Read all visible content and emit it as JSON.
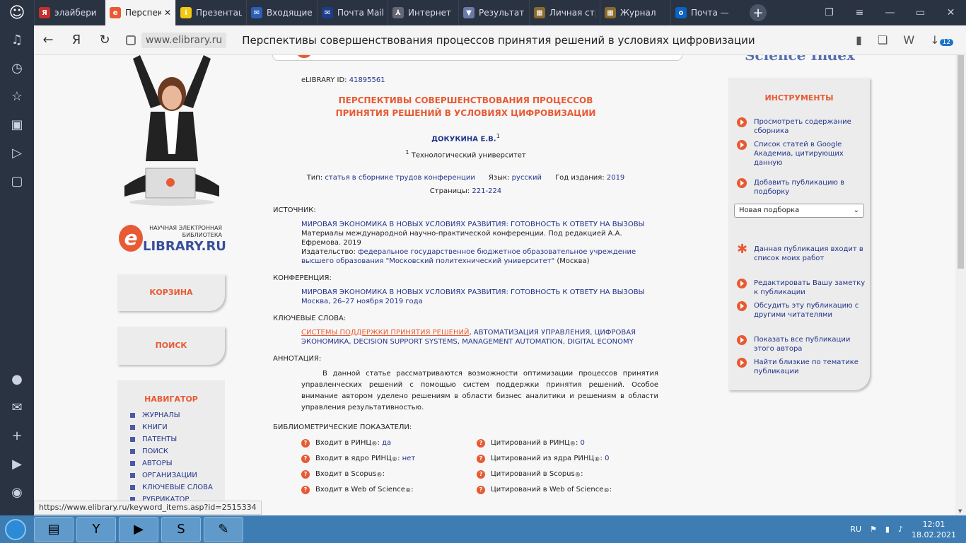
{
  "tabs": [
    {
      "label": "элайбери",
      "color": "#c4302b",
      "glyph": "Я"
    },
    {
      "label": "Перспективы",
      "color": "#e85a33",
      "glyph": "e",
      "active": true
    },
    {
      "label": "Презентация",
      "color": "#f2c811",
      "glyph": "i"
    },
    {
      "label": "Входящие",
      "color": "#2b5eb5",
      "glyph": "✉"
    },
    {
      "label": "Почта Mail",
      "color": "#1e3c8c",
      "glyph": "✉"
    },
    {
      "label": "Интернет",
      "color": "#667",
      "glyph": "⅄"
    },
    {
      "label": "Результаты",
      "color": "#6a7aa8",
      "glyph": "▼"
    },
    {
      "label": "Личная страница",
      "color": "#8a6a2a",
      "glyph": "▦"
    },
    {
      "label": "Журнал",
      "color": "#8a6a2a",
      "glyph": "▦"
    },
    {
      "label": "Почта —",
      "color": "#0a64c4",
      "glyph": "o"
    }
  ],
  "address": {
    "domain": "www.elibrary.ru",
    "title": "Перспективы совершенствования процессов принятия решений в условиях цифровизации",
    "downloads": "12"
  },
  "sidebar_logo": {
    "small": "НАУЧНАЯ ЭЛЕКТРОННАЯ БИБЛИОТЕКА",
    "big": "LIBRARY.RU",
    "e": "e"
  },
  "left": {
    "cart": "КОРЗИНА",
    "search": "ПОИСК",
    "nav_title": "НАВИГАТОР",
    "nav_items": [
      "ЖУРНАЛЫ",
      "КНИГИ",
      "ПАТЕНТЫ",
      "ПОИСК",
      "АВТОРЫ",
      "ОРГАНИЗАЦИИ",
      "КЛЮЧЕВЫЕ СЛОВА",
      "РУБРИКАТОР"
    ]
  },
  "science_index": "Science Index",
  "article": {
    "id_label": "eLIBRARY ID:",
    "id": "41895561",
    "title": "ПЕРСПЕКТИВЫ СОВЕРШЕНСТВОВАНИЯ ПРОЦЕССОВ ПРИНЯТИЯ РЕШЕНИЙ В УСЛОВИЯХ ЦИФРОВИЗАЦИИ",
    "author": "ДОКУКИНА Е.В.",
    "author_sup": "1",
    "aff_sup": "1",
    "affiliation": "Технологический университет",
    "type_label": "Тип:",
    "type": "статья в сборнике трудов конференции",
    "lang_label": "Язык:",
    "lang": "русский",
    "year_label": "Год издания:",
    "year": "2019",
    "pages_label": "Страницы:",
    "pages": "221-224",
    "source_h": "ИСТОЧНИК:",
    "source_title": "МИРОВАЯ ЭКОНОМИКА В НОВЫХ УСЛОВИЯХ РАЗВИТИЯ: ГОТОВНОСТЬ К ОТВЕТУ НА ВЫЗОВЫ",
    "source_l2": "Материалы международной научно-практической конференции. Под редакцией А.А. Ефремова. 2019",
    "source_l3a": "Издательство:",
    "source_l3b": "федеральное государственное бюджетное образовательное учреждение высшего образования \"Московский политехнический университет\"",
    "source_l3c": "(Москва)",
    "conf_h": "КОНФЕРЕНЦИЯ:",
    "conf_title": "МИРОВАЯ ЭКОНОМИКА В НОВЫХ УСЛОВИЯХ РАЗВИТИЯ: ГОТОВНОСТЬ К ОТВЕТУ НА ВЫЗОВЫ",
    "conf_place": "Москва, 26–27 ноября 2019 года",
    "kw_h": "КЛЮЧЕВЫЕ СЛОВА:",
    "kw_first": "СИСТЕМЫ ПОДДЕРЖКИ ПРИНЯТИЯ РЕШЕНИЙ",
    "kw_rest": ", АВТОМАТИЗАЦИЯ УПРАВЛЕНИЯ, ЦИФРОВАЯ ЭКОНОМИКА, DECISION SUPPORT SYSTEMS, MANAGEMENT AUTOMATION, DIGITAL ECONOMY",
    "abs_h": "АННОТАЦИЯ:",
    "abstract": "В данной статье рассматриваются возможности оптимизации процессов принятия управленческих решений с помощью систем поддержки принятия решений. Особое внимание автором уделено решениям в области бизнес аналитики и решениям в области управления результативностью.",
    "bib_h": "БИБЛИОМЕТРИЧЕСКИЕ ПОКАЗАТЕЛИ:",
    "bib_left": [
      [
        "Входит в РИНЦ",
        "да"
      ],
      [
        "Входит в ядро РИНЦ",
        "нет"
      ],
      [
        "Входит в Scopus",
        ""
      ],
      [
        "Входит в Web of Science",
        ""
      ]
    ],
    "bib_right": [
      [
        "Цитирований в РИНЦ",
        "0"
      ],
      [
        "Цитирований из ядра РИНЦ",
        "0"
      ],
      [
        "Цитирований в Scopus",
        ""
      ],
      [
        "Цитирований в Web of Science",
        ""
      ]
    ]
  },
  "tools": {
    "title": "ИНСТРУМЕНТЫ",
    "items": [
      "Просмотреть содержание сборника",
      "Список статей в Google Академиа, цитирующих данную",
      "Добавить публикацию в подборку",
      "Данная публикация входит в список моих работ",
      "Редактировать Вашу заметку к публикации",
      "Обсудить эту публикацию с другими читателями",
      "Показать все публикации этого автора",
      "Найти близкие по тематике публикации"
    ],
    "select": "Новая подборка"
  },
  "status_url": "https://www.elibrary.ru/keyword_items.asp?id=2515334",
  "taskbar": {
    "lang": "RU",
    "time": "12:01",
    "date": "18.02.2021"
  }
}
